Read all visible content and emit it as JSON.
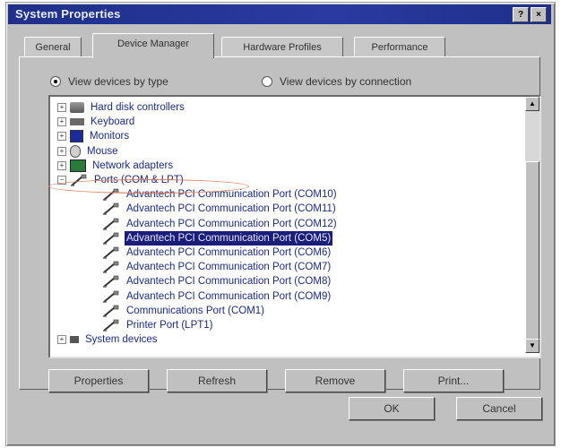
{
  "window": {
    "title": "System Properties",
    "help_glyph": "?",
    "close_glyph": "×"
  },
  "tabs": [
    {
      "label": "General"
    },
    {
      "label": "Device Manager",
      "active": true
    },
    {
      "label": "Hardware Profiles"
    },
    {
      "label": "Performance"
    }
  ],
  "view": {
    "by_type": "View devices by type",
    "by_connection": "View devices by connection",
    "selected": "by_type"
  },
  "tree": {
    "items": [
      {
        "label": "Hard disk controllers",
        "icon": "hard-disk-icon",
        "expander": "+"
      },
      {
        "label": "Keyboard",
        "icon": "keyboard-icon",
        "expander": "+"
      },
      {
        "label": "Monitors",
        "icon": "monitor-icon",
        "expander": "+"
      },
      {
        "label": "Mouse",
        "icon": "mouse-icon",
        "expander": "+"
      },
      {
        "label": "Network adapters",
        "icon": "network-icon",
        "expander": "+"
      },
      {
        "label": "Ports (COM & LPT)",
        "icon": "port-icon",
        "expander": "−"
      },
      {
        "label": "Advantech PCI Communication Port (COM10)",
        "icon": "port-icon"
      },
      {
        "label": "Advantech PCI Communication Port (COM11)",
        "icon": "port-icon"
      },
      {
        "label": "Advantech PCI Communication Port (COM12)",
        "icon": "port-icon"
      },
      {
        "label": "Advantech PCI Communication Port (COM5)",
        "icon": "port-icon",
        "selected": true
      },
      {
        "label": "Advantech PCI Communication Port (COM6)",
        "icon": "port-icon"
      },
      {
        "label": "Advantech PCI Communication Port (COM7)",
        "icon": "port-icon"
      },
      {
        "label": "Advantech PCI Communication Port (COM8)",
        "icon": "port-icon"
      },
      {
        "label": "Advantech PCI Communication Port (COM9)",
        "icon": "port-icon"
      },
      {
        "label": "Communications Port (COM1)",
        "icon": "port-icon"
      },
      {
        "label": "Printer Port (LPT1)",
        "icon": "port-icon"
      },
      {
        "label": "System devices",
        "icon": "system-devices-icon",
        "expander": "+"
      }
    ]
  },
  "buttons": {
    "properties": "Properties",
    "refresh": "Refresh",
    "remove": "Remove",
    "print": "Print...",
    "ok": "OK",
    "cancel": "Cancel"
  },
  "colors": {
    "titlebar": "#1f2f8a",
    "selection": "#1a1e7a",
    "annotation": "#e07a5a"
  }
}
